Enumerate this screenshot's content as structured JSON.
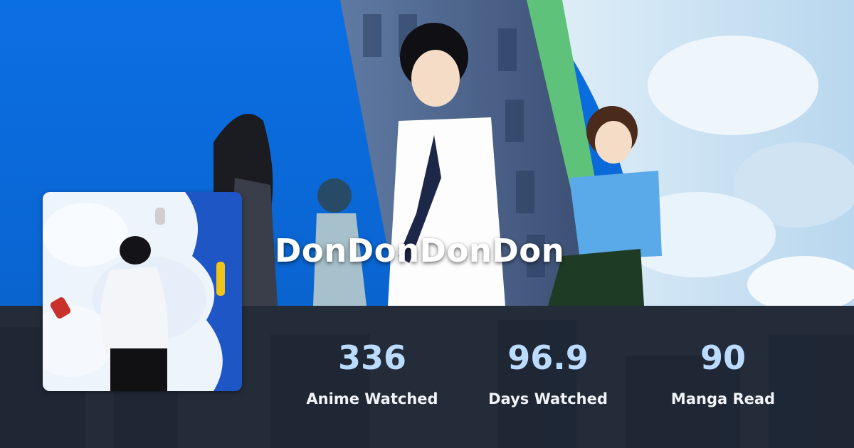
{
  "profile": {
    "username": "DonDonDonDon"
  },
  "stats": [
    {
      "value": "336",
      "label": "Anime Watched"
    },
    {
      "value": "96.9",
      "label": "Days Watched"
    },
    {
      "value": "90",
      "label": "Manga Read"
    }
  ],
  "colors": {
    "stat_value": "#bcdcff",
    "stat_label": "#f2f4f7",
    "stats_bar": "#141e2a",
    "banner_sky": "#0a6ee0"
  }
}
